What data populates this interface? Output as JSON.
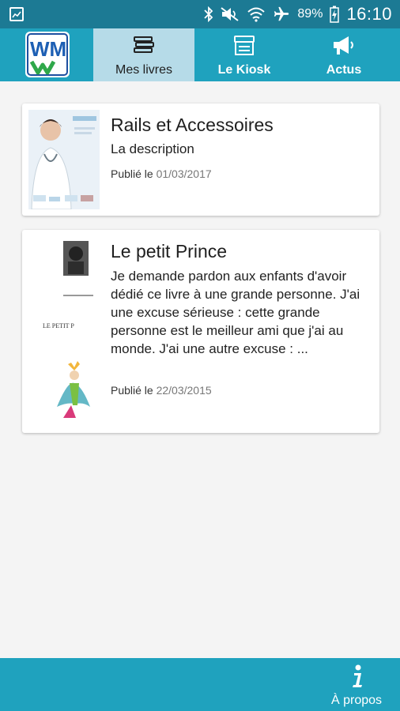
{
  "status_bar": {
    "battery": "89%",
    "time": "16:10"
  },
  "logo": {
    "letters": "WM"
  },
  "tabs": [
    {
      "label": "Mes livres",
      "icon": "books-icon",
      "active": true
    },
    {
      "label": "Le Kiosk",
      "icon": "kiosk-icon",
      "active": false
    },
    {
      "label": "Actus",
      "icon": "megaphone-icon",
      "active": false
    }
  ],
  "books": [
    {
      "title": "Rails et Accessoires",
      "description": "La description",
      "published_prefix": "Publié le",
      "published_date": "01/03/2017"
    },
    {
      "title": "Le petit Prince",
      "description": "Je demande pardon aux enfants d'avoir dédié ce livre à une grande personne. J'ai une excuse sérieuse : cette grande personne est le meilleur ami que j'ai au monde. J'ai une autre excuse : ...",
      "published_prefix": "Publié le",
      "published_date": "22/03/2015",
      "cover_text": "LE PETIT P"
    }
  ],
  "bottom_bar": {
    "about_label": "À propos"
  },
  "colors": {
    "status_bar": "#1c7a94",
    "tab_bar": "#1fa2be",
    "tab_active": "#b6dbe8",
    "background": "#f4f4f4"
  }
}
